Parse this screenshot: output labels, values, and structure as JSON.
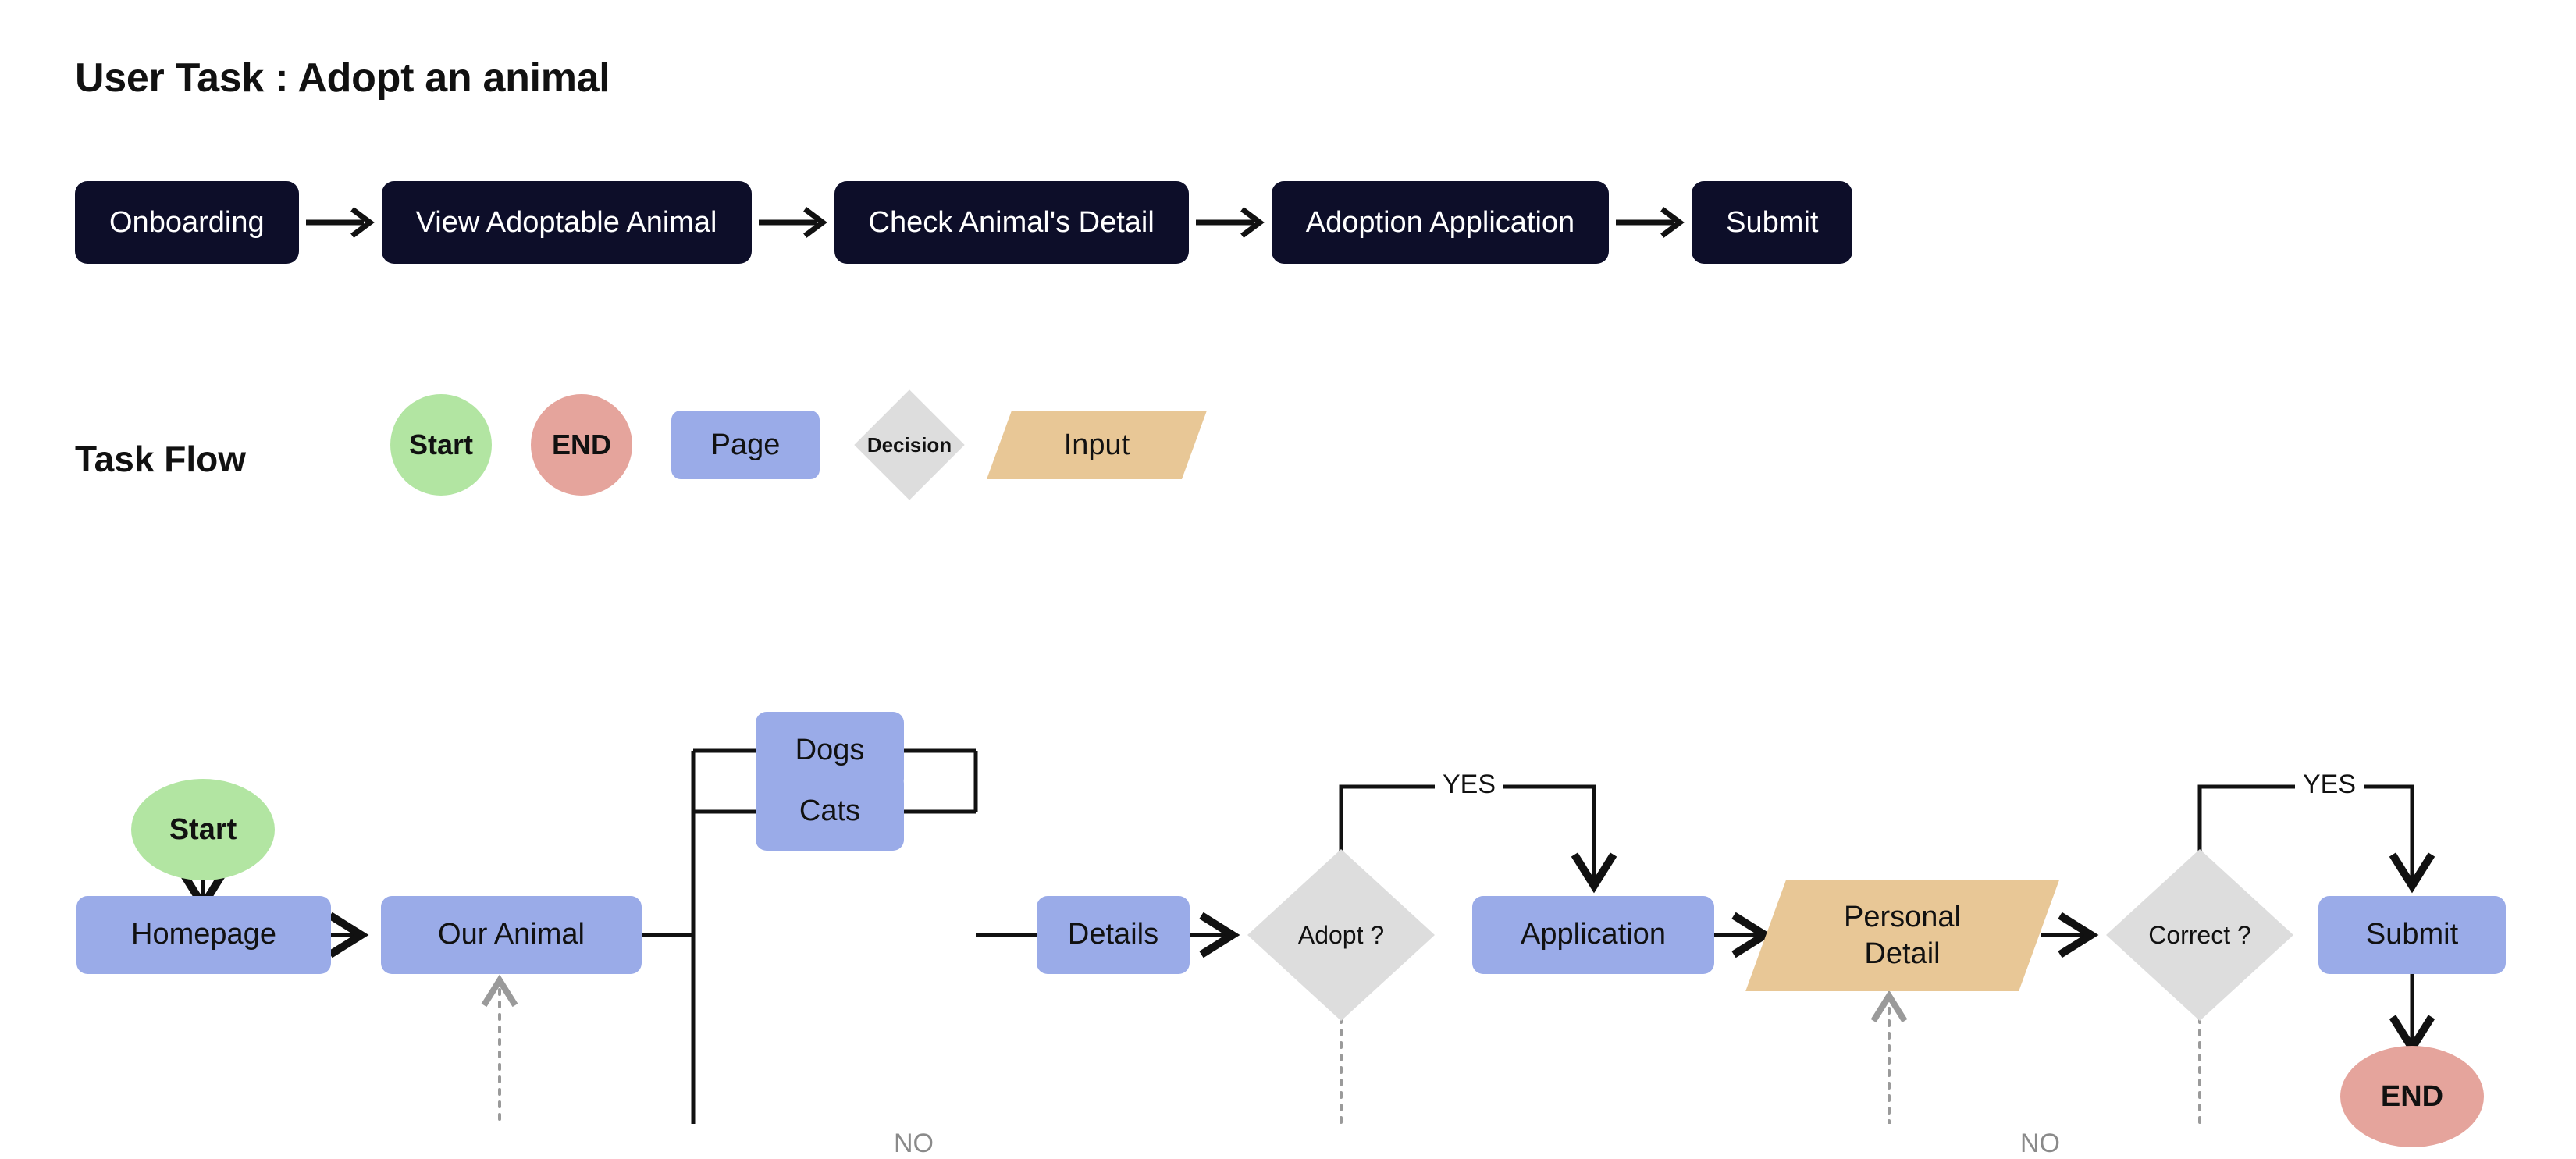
{
  "page": {
    "title": "User Task : Adopt an animal",
    "taskflow_title": "Task Flow"
  },
  "pipeline": {
    "arrow_icon": "arrow-right-icon",
    "steps": [
      {
        "label": "Onboarding"
      },
      {
        "label": "View Adoptable Animal"
      },
      {
        "label": "Check Animal's Detail"
      },
      {
        "label": "Adoption Application"
      },
      {
        "label": "Submit"
      }
    ]
  },
  "legend": {
    "items": [
      {
        "label": "Start",
        "shape": "circle",
        "color": "#b2e5a2"
      },
      {
        "label": "END",
        "shape": "circle",
        "color": "#e5a49c"
      },
      {
        "label": "Page",
        "shape": "rounded-rect",
        "color": "#9aabe8"
      },
      {
        "label": "Decision",
        "shape": "diamond",
        "color": "#dddddd"
      },
      {
        "label": "Input",
        "shape": "parallelogram",
        "color": "#e8c796"
      }
    ]
  },
  "flow": {
    "nodes": [
      {
        "id": "start",
        "label": "Start",
        "shape": "circle",
        "color": "#b2e5a2"
      },
      {
        "id": "homepage",
        "label": "Homepage",
        "shape": "rounded-rect",
        "color": "#9aabe8"
      },
      {
        "id": "our-animal",
        "label": "Our Animal",
        "shape": "rounded-rect",
        "color": "#9aabe8"
      },
      {
        "id": "dogs",
        "label": "Dogs",
        "shape": "rounded-rect",
        "color": "#9aabe8"
      },
      {
        "id": "cats",
        "label": "Cats",
        "shape": "rounded-rect",
        "color": "#9aabe8"
      },
      {
        "id": "details",
        "label": "Details",
        "shape": "rounded-rect",
        "color": "#9aabe8"
      },
      {
        "id": "adopt",
        "label": "Adopt ?",
        "shape": "diamond",
        "color": "#dddddd"
      },
      {
        "id": "application",
        "label": "Application",
        "shape": "rounded-rect",
        "color": "#9aabe8"
      },
      {
        "id": "personal-1",
        "label": "Personal",
        "shape": "parallelogram",
        "color": "#e8c796"
      },
      {
        "id": "personal-2",
        "label": "Detail",
        "shape": "parallelogram",
        "color": "#e8c796"
      },
      {
        "id": "correct",
        "label": "Correct ?",
        "shape": "diamond",
        "color": "#dddddd"
      },
      {
        "id": "submit",
        "label": "Submit",
        "shape": "rounded-rect",
        "color": "#9aabe8"
      },
      {
        "id": "end",
        "label": "END",
        "shape": "circle",
        "color": "#e5a49c"
      }
    ],
    "edge_labels": {
      "adopt_yes": "YES",
      "adopt_no": "NO",
      "correct_yes": "YES",
      "correct_no": "NO"
    }
  },
  "colors": {
    "pipeline_pill": "#0d0e29",
    "pipeline_text": "#ffffff",
    "page_node": "#9aabe8",
    "start_node": "#b2e5a2",
    "end_node": "#e5a49c",
    "decision_node": "#dddddd",
    "input_node": "#e8c796",
    "wire": "#111111",
    "wire_dotted": "#9a9a9a",
    "background": "#ffffff"
  }
}
